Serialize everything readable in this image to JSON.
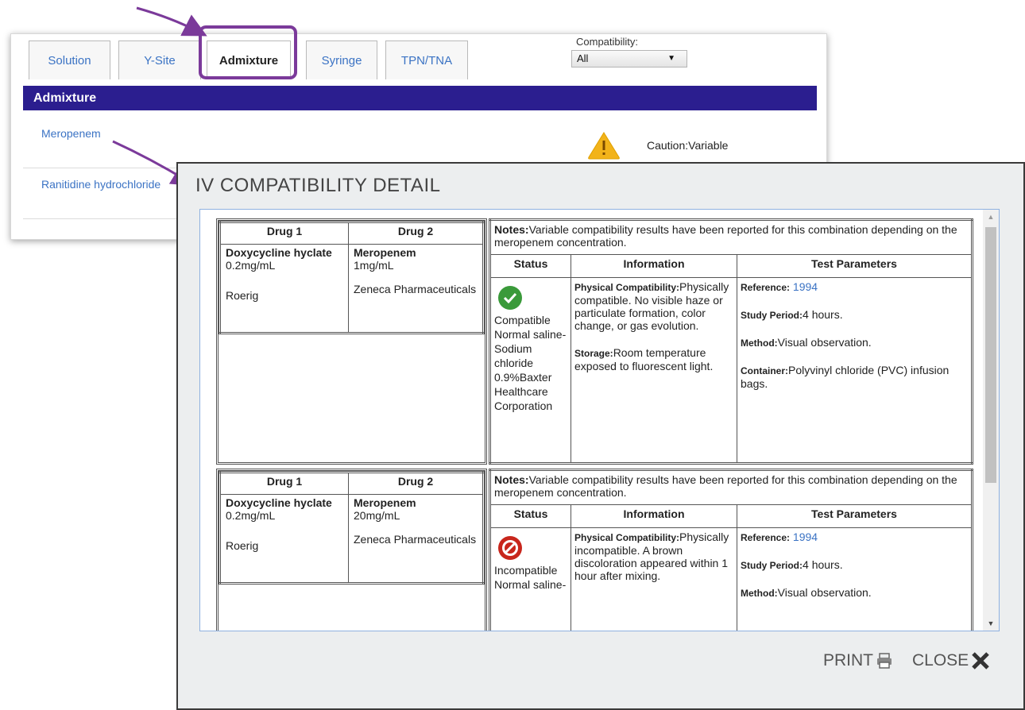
{
  "tabs": [
    "Solution",
    "Y-Site",
    "Admixture",
    "Syringe",
    "TPN/TNA"
  ],
  "compatibility": {
    "label": "Compatibility:",
    "selected": "All"
  },
  "section_title": "Admixture",
  "drugs": [
    "Meropenem",
    "Ranitidine hydrochloride"
  ],
  "caution_text": "Caution:Variable",
  "modal": {
    "title": "IV COMPATIBILITY DETAIL",
    "print_label": "PRINT",
    "close_label": "CLOSE"
  },
  "table_headers": {
    "drug1": "Drug 1",
    "drug2": "Drug 2",
    "status": "Status",
    "information": "Information",
    "test_params": "Test Parameters"
  },
  "records": [
    {
      "drug1_name": "Doxycycline hyclate",
      "drug1_conc": "0.2mg/mL",
      "drug1_mfr": "Roerig",
      "drug2_name": "Meropenem",
      "drug2_conc": "1mg/mL",
      "drug2_mfr": "Zeneca Pharmaceuticals",
      "notes_label": "Notes:",
      "notes": "Variable compatibility results have been reported for this combination depending on the meropenem concentration.",
      "status": "Compatible Normal saline-Sodium chloride 0.9%Baxter Healthcare Corporation",
      "phys_label": "Physical Compatibility:",
      "phys_text": "Physically compatible. No visible haze or particulate formation, color change, or gas evolution.",
      "storage_label": "Storage:",
      "storage_text": "Room temperature exposed to fluorescent light.",
      "reference_label": "Reference:",
      "reference": "1994",
      "study_label": "Study Period:",
      "study": "4 hours.",
      "method_label": "Method:",
      "method": "Visual observation.",
      "container_label": "Container:",
      "container": "Polyvinyl chloride (PVC) infusion bags."
    },
    {
      "drug1_name": "Doxycycline hyclate",
      "drug1_conc": "0.2mg/mL",
      "drug1_mfr": "Roerig",
      "drug2_name": "Meropenem",
      "drug2_conc": "20mg/mL",
      "drug2_mfr": "Zeneca Pharmaceuticals",
      "notes_label": "Notes:",
      "notes": "Variable compatibility results have been reported for this combination depending on the meropenem concentration.",
      "status": "Incompatible Normal saline-",
      "phys_label": "Physical Compatibility:",
      "phys_text": "Physically incompatible. A brown discoloration appeared within 1 hour after mixing.",
      "reference_label": "Reference:",
      "reference": "1994",
      "study_label": "Study Period:",
      "study": "4 hours.",
      "method_label": "Method:",
      "method": "Visual observation."
    }
  ],
  "icons": {
    "compatible": "check-circle-icon",
    "incompatible": "no-entry-icon",
    "caution": "warning-triangle-icon",
    "print": "printer-icon",
    "close": "close-x-icon"
  },
  "colors": {
    "section_bar": "#2b1e8f",
    "link": "#3b73c4",
    "highlight": "#7b3a9a",
    "compatible": "#3a9a3a",
    "incompatible": "#c8261c",
    "warning": "#f2b31a"
  }
}
